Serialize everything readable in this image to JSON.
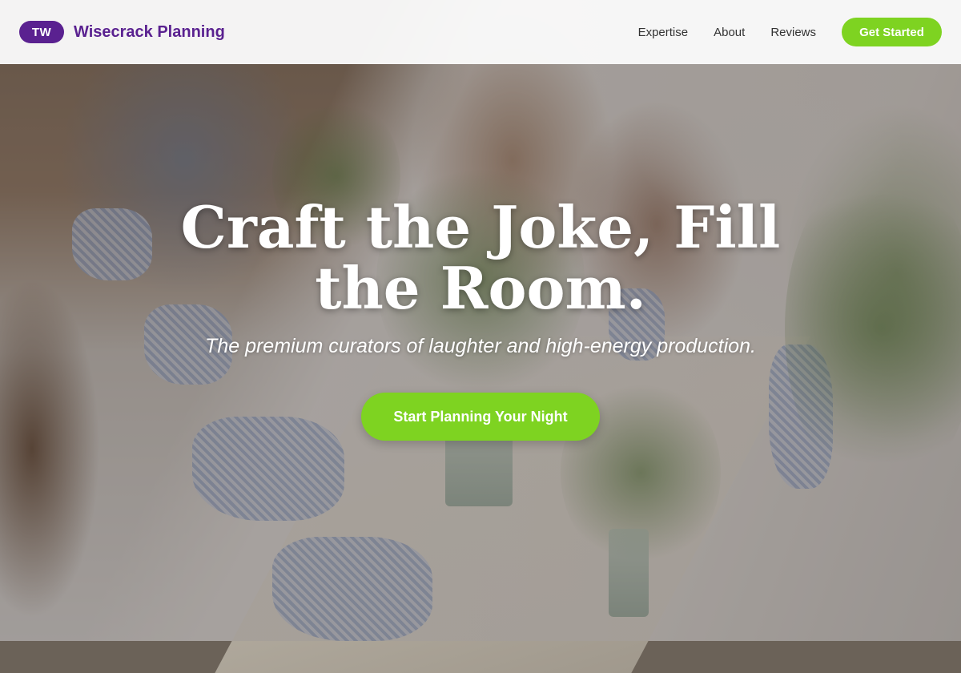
{
  "header": {
    "logo_initials": "TW",
    "brand_name": "Wisecrack Planning",
    "nav": [
      {
        "label": "Expertise"
      },
      {
        "label": "About"
      },
      {
        "label": "Reviews"
      }
    ],
    "cta_label": "Get Started"
  },
  "hero": {
    "title": "Craft the Joke, Fill the Room.",
    "subtitle": "The premium curators of laughter and high-energy production.",
    "cta_label": "Start Planning Your Night",
    "background_image": "banquet-table-photo"
  },
  "colors": {
    "brand_purple": "#5a2190",
    "accent_green": "#7ed321",
    "header_bg": "#fafafa",
    "nav_text": "#333333"
  }
}
